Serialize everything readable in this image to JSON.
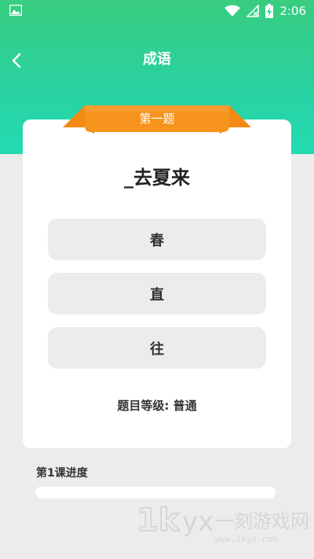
{
  "status_bar": {
    "time": "2:06"
  },
  "header": {
    "title": "成语"
  },
  "quiz": {
    "badge": "第一题",
    "question": "_去夏来",
    "options": [
      "春",
      "直",
      "往"
    ],
    "level_text": "题目等级: 普通"
  },
  "progress": {
    "label": "第1课进度",
    "value": 0
  },
  "watermark": {
    "text": "1kyx 一刻游戏网",
    "url": "www.1kyx.com"
  },
  "colors": {
    "header_top": "#38cd7f",
    "header_bottom": "#22dbb1",
    "ribbon": "#f7941d",
    "background": "#ececec"
  }
}
